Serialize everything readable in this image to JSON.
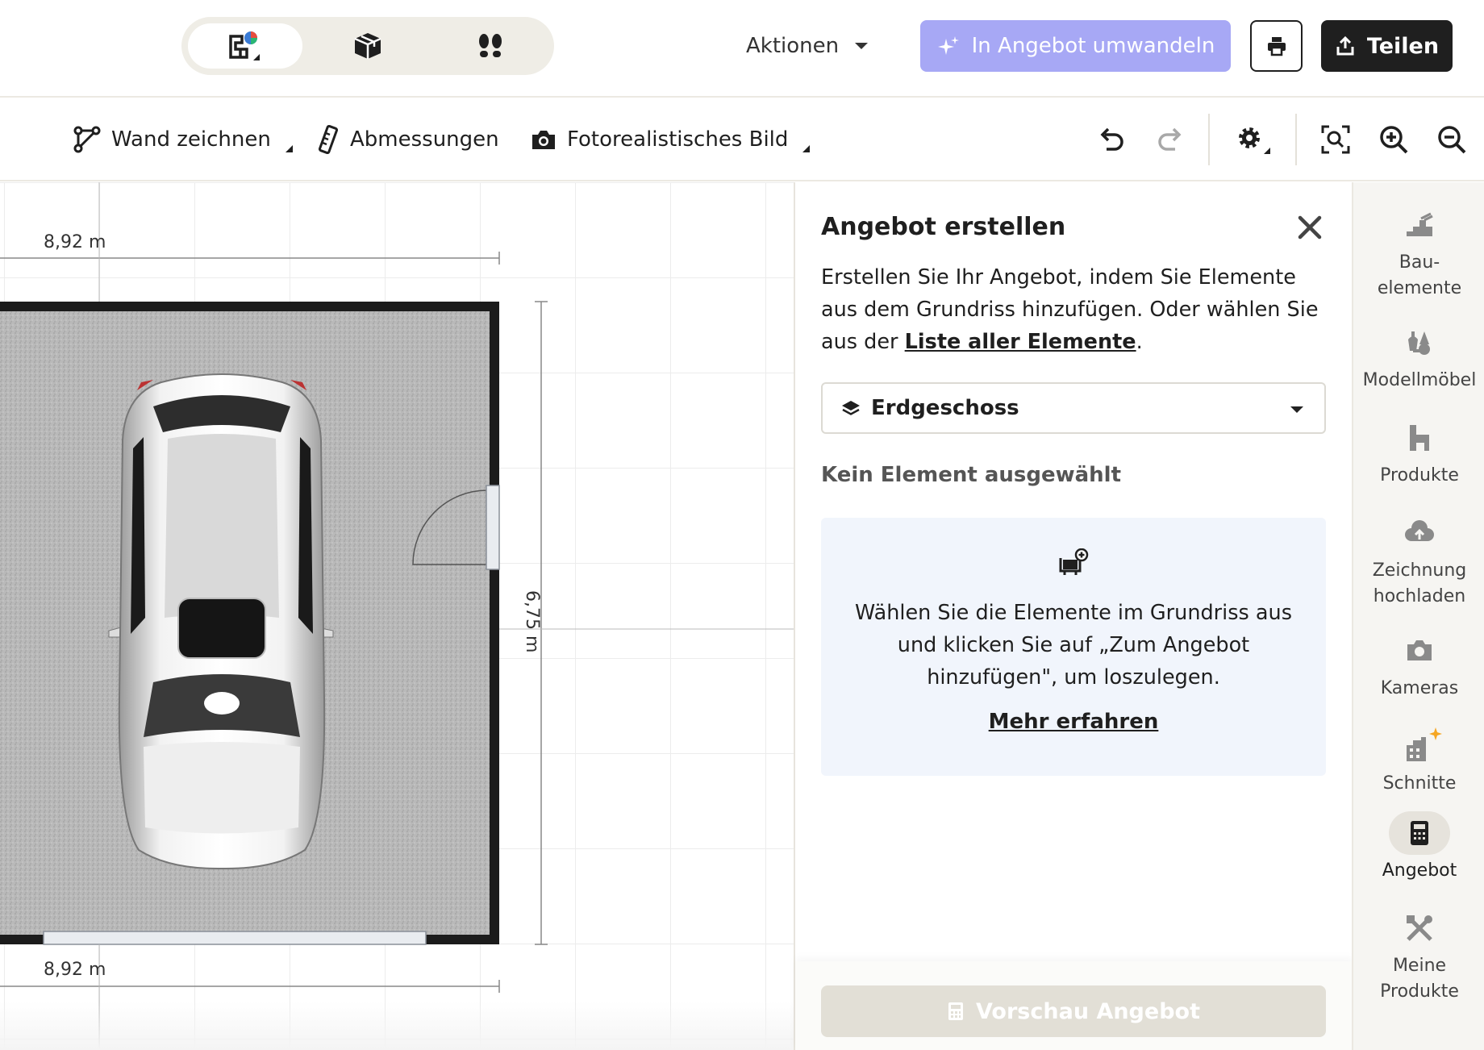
{
  "header": {
    "view_switch": [
      {
        "icon": "floorplan-2d-icon",
        "active": true
      },
      {
        "icon": "cube-3d-icon",
        "active": false
      },
      {
        "icon": "footsteps-icon",
        "active": false
      }
    ],
    "actions_label": "Aktionen",
    "convert_label": "In Angebot umwandeln",
    "print_icon": "printer-icon",
    "share_label": "Teilen"
  },
  "toolbar": {
    "draw_wall": "Wand zeichnen",
    "dimensions": "Abmessungen",
    "photo": "Fotorealistisches Bild",
    "icons": [
      "undo-icon",
      "redo-icon",
      "settings-icon",
      "zoom-fit-icon",
      "zoom-in-icon",
      "zoom-out-icon"
    ]
  },
  "canvas": {
    "dim_top": "8,92 m",
    "dim_bottom": "8,92 m",
    "dim_right": "6,75 m"
  },
  "panel": {
    "title": "Angebot erstellen",
    "desc_part1": "Erstellen Sie Ihr Angebot, indem Sie Elemente aus dem Grundriss hinzufügen. Oder wählen Sie aus der ",
    "desc_link": "Liste aller Elemente",
    "desc_part2": ".",
    "floor": "Erdgeschoss",
    "no_element": "Kein Element ausgewählt",
    "info_text": "Wählen Sie die Elemente im Grundriss aus und klicken Sie auf „Zum Angebot hinzufügen\", um loszulegen.",
    "info_link": "Mehr erfahren",
    "preview_label": "Vorschau Angebot"
  },
  "sidebar": {
    "items": [
      {
        "label": "Bau-\nelemente",
        "icon": "building-elements-icon",
        "active": false
      },
      {
        "label": "Modellmöbel",
        "icon": "furniture-icon",
        "active": false
      },
      {
        "label": "Produkte",
        "icon": "products-icon",
        "active": false
      },
      {
        "label": "Zeichnung\nhochladen",
        "icon": "upload-cloud-icon",
        "active": false
      },
      {
        "label": "Kameras",
        "icon": "camera-icon",
        "active": false
      },
      {
        "label": "Schnitte",
        "icon": "sections-icon",
        "active": false
      },
      {
        "label": "Angebot",
        "icon": "calculator-icon",
        "active": true
      },
      {
        "label": "Meine\nProdukte",
        "icon": "my-products-icon",
        "active": false
      }
    ]
  },
  "colors": {
    "accent_disabled": "#a7a8f5",
    "dark": "#1f1f1f",
    "info_bg": "#f1f5fc"
  }
}
